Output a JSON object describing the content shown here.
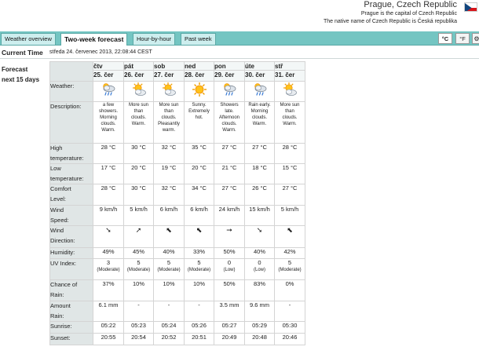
{
  "location": {
    "title": "Prague, Czech Republic",
    "line1": "Prague is the capital of Czech Republic",
    "line2": "The native name of Czech Republic is Česká republika"
  },
  "flag": {
    "icon": "czech-flag-icon",
    "colors": [
      "#ffffff",
      "#d7141a",
      "#11457e"
    ]
  },
  "tabs": [
    {
      "label": "Weather overview",
      "active": false
    },
    {
      "label": "Two-week forecast",
      "active": true
    },
    {
      "label": "Hour-by-hour",
      "active": false
    },
    {
      "label": "Past week",
      "active": false
    }
  ],
  "units": {
    "celsius": "°C",
    "fahrenheit": "°F",
    "settings_icon": "gear-icon"
  },
  "current_time": {
    "label": "Current Time",
    "value": "středa 24. červenec 2013, 22:08:44 CEST"
  },
  "forecast": {
    "label_line1": "Forecast",
    "label_line2": "next 15 days"
  },
  "rows": {
    "weather": "Weather:",
    "description": "Description:",
    "high": [
      "High",
      "temperature:"
    ],
    "low": [
      "Low",
      "temperature:"
    ],
    "comfort": [
      "Comfort",
      "Level:"
    ],
    "wind_speed": [
      "Wind",
      "Speed:"
    ],
    "wind_dir": [
      "Wind",
      "Direction:"
    ],
    "humidity": "Humidity:",
    "uv": "UV Index:",
    "rain_chance": [
      "Chance of",
      "Rain:"
    ],
    "rain_amount": [
      "Amount",
      "Rain:"
    ],
    "sunrise": "Sunrise:",
    "sunset": "Sunset:"
  },
  "days": [
    {
      "name": "čtv",
      "date": "25. čer",
      "icon": "cloud-rain-icon",
      "desc": [
        "a few",
        "showers.",
        "Morning",
        "clouds.",
        "Warm."
      ],
      "high": "28 °C",
      "low": "17 °C",
      "comfort": "28 °C",
      "wind": "9 km/h",
      "arrow": "➘",
      "humidity": "49%",
      "uv": "3",
      "uvc": "(Moderate)",
      "rain": "37%",
      "amount": "6.1 mm",
      "sunrise": "05:22",
      "sunset": "20:55"
    },
    {
      "name": "pát",
      "date": "26. čer",
      "icon": "sun-cloud-icon",
      "desc": [
        "More sun",
        "than",
        "clouds.",
        "Warm."
      ],
      "high": "30 °C",
      "low": "20 °C",
      "comfort": "30 °C",
      "wind": "5 km/h",
      "arrow": "➚",
      "humidity": "45%",
      "uv": "5",
      "uvc": "(Moderate)",
      "rain": "10%",
      "amount": "-",
      "sunrise": "05:23",
      "sunset": "20:54"
    },
    {
      "name": "sob",
      "date": "27. čer",
      "icon": "sun-cloud-icon",
      "desc": [
        "More sun",
        "than",
        "clouds.",
        "Pleasantly",
        "warm."
      ],
      "high": "32 °C",
      "low": "19 °C",
      "comfort": "32 °C",
      "wind": "6 km/h",
      "arrow": "⬉",
      "humidity": "40%",
      "uv": "5",
      "uvc": "(Moderate)",
      "rain": "10%",
      "amount": "-",
      "sunrise": "05:24",
      "sunset": "20:52"
    },
    {
      "name": "ned",
      "date": "28. čer",
      "icon": "sun-icon",
      "desc": [
        "Sunny.",
        "Extremely",
        "hot."
      ],
      "high": "35 °C",
      "low": "20 °C",
      "comfort": "34 °C",
      "wind": "6 km/h",
      "arrow": "⬉",
      "humidity": "33%",
      "uv": "5",
      "uvc": "(Moderate)",
      "rain": "10%",
      "amount": "-",
      "sunrise": "05:26",
      "sunset": "20:51"
    },
    {
      "name": "pon",
      "date": "29. čer",
      "icon": "cloud-rain-icon",
      "desc": [
        "Showers",
        "late.",
        "Afternoon",
        "clouds.",
        "Warm."
      ],
      "high": "27 °C",
      "low": "21 °C",
      "comfort": "27 °C",
      "wind": "24 km/h",
      "arrow": "➞",
      "humidity": "50%",
      "uv": "0",
      "uvc": "(Low)",
      "rain": "50%",
      "amount": "3.5 mm",
      "sunrise": "05:27",
      "sunset": "20:49"
    },
    {
      "name": "úte",
      "date": "30. čer",
      "icon": "cloud-rain-icon",
      "desc": [
        "Rain early.",
        "Morning",
        "clouds.",
        "Warm."
      ],
      "high": "27 °C",
      "low": "18 °C",
      "comfort": "26 °C",
      "wind": "15 km/h",
      "arrow": "➘",
      "humidity": "40%",
      "uv": "0",
      "uvc": "(Low)",
      "rain": "83%",
      "amount": "9.6 mm",
      "sunrise": "05:29",
      "sunset": "20:48"
    },
    {
      "name": "stř",
      "date": "31. čer",
      "icon": "sun-cloud-icon",
      "desc": [
        "More sun",
        "than",
        "clouds.",
        "Warm."
      ],
      "high": "28 °C",
      "low": "15 °C",
      "comfort": "27 °C",
      "wind": "5 km/h",
      "arrow": "⬉",
      "humidity": "42%",
      "uv": "5",
      "uvc": "(Moderate)",
      "rain": "0%",
      "amount": "-",
      "sunrise": "05:30",
      "sunset": "20:46"
    }
  ]
}
